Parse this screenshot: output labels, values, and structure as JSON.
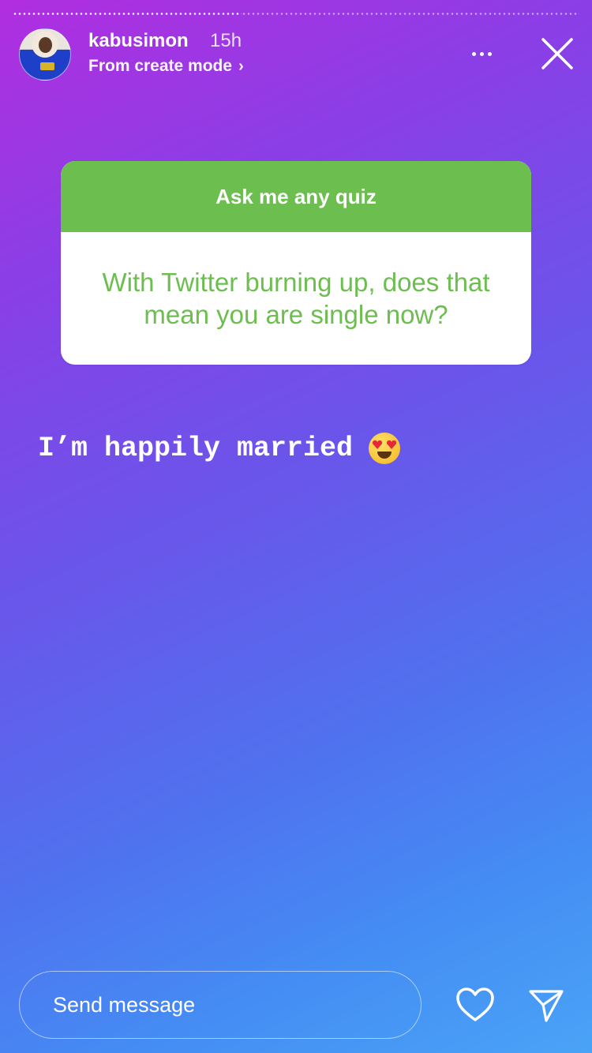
{
  "story": {
    "progress": 0.4,
    "user": {
      "username": "kabusimon",
      "time_ago": "15h",
      "subtitle": "From create mode"
    }
  },
  "quiz": {
    "header": "Ask me any quiz",
    "question": "With Twitter burning up, does that mean you are single now?",
    "accent_color": "#6cbe4f"
  },
  "answer": {
    "text": "I’m happily married",
    "emoji": "smiling-face-with-heart-eyes"
  },
  "footer": {
    "message_placeholder": "Send message"
  },
  "icons": {
    "more": "more-horizontal-icon",
    "close": "close-icon",
    "like": "heart-icon",
    "share": "send-paper-plane-icon"
  }
}
